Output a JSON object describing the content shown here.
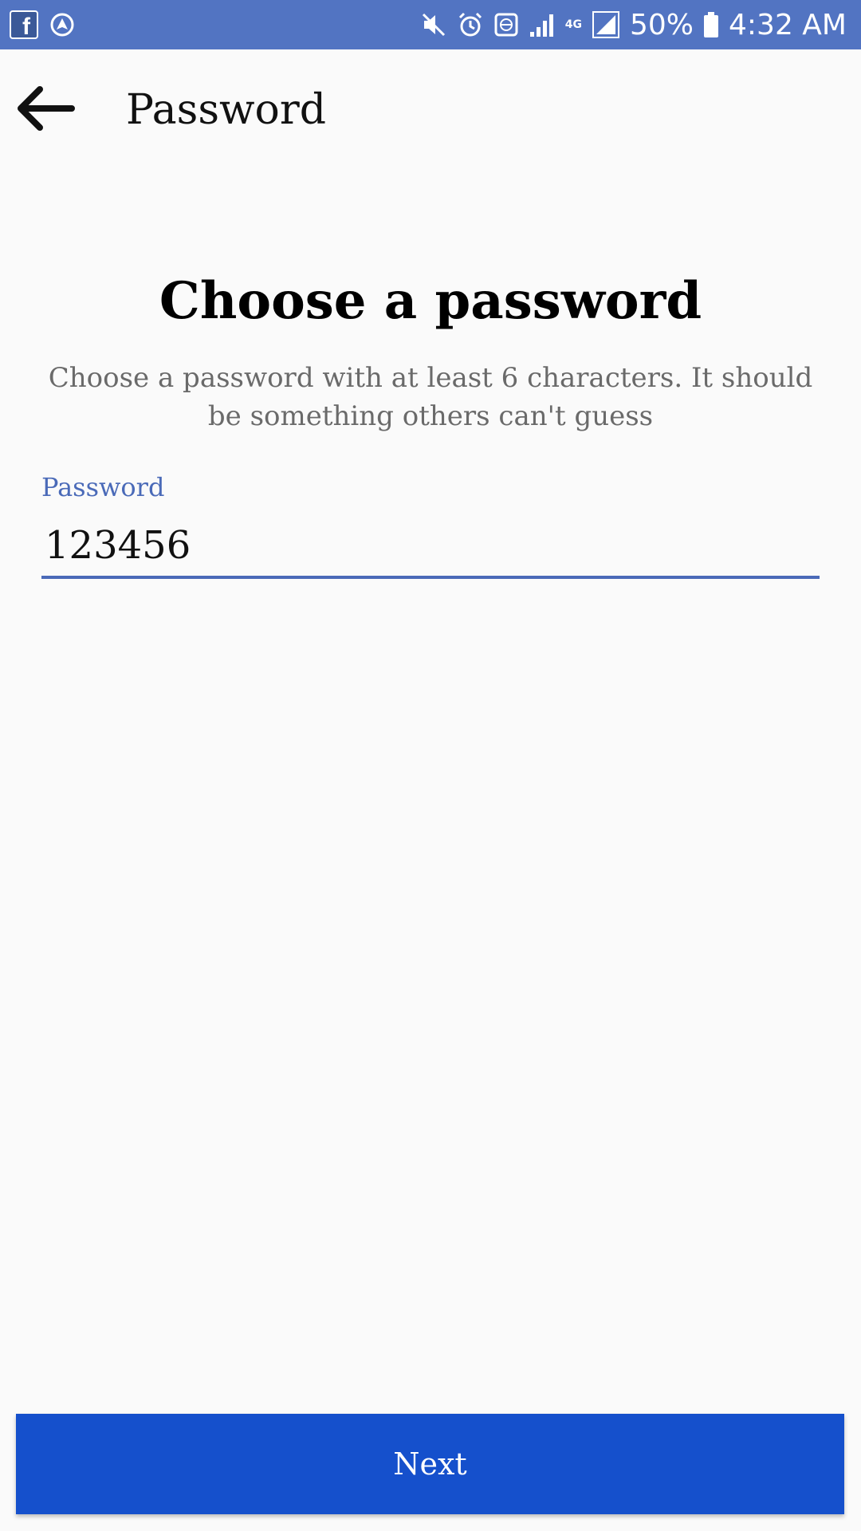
{
  "status_bar": {
    "battery_percent": "50%",
    "time": "4:32 AM",
    "network_type": "4G",
    "bg_color": "#5274c2",
    "icons": [
      "facebook-icon",
      "navigation-icon",
      "mute-icon",
      "alarm-icon",
      "vpn-icon",
      "signal-icon",
      "data-arrows-icon",
      "signal-2-icon",
      "battery-icon"
    ]
  },
  "app_bar": {
    "title": "Password",
    "back_icon": "arrow-left-icon"
  },
  "main": {
    "heading": "Choose a password",
    "subtitle": "Choose a password with at least 6 characters. It should be something others can't guess",
    "field_label": "Password",
    "password_value": "123456",
    "accent_color": "#4a6ab8"
  },
  "footer": {
    "next_label": "Next",
    "button_color": "#1550cc"
  }
}
